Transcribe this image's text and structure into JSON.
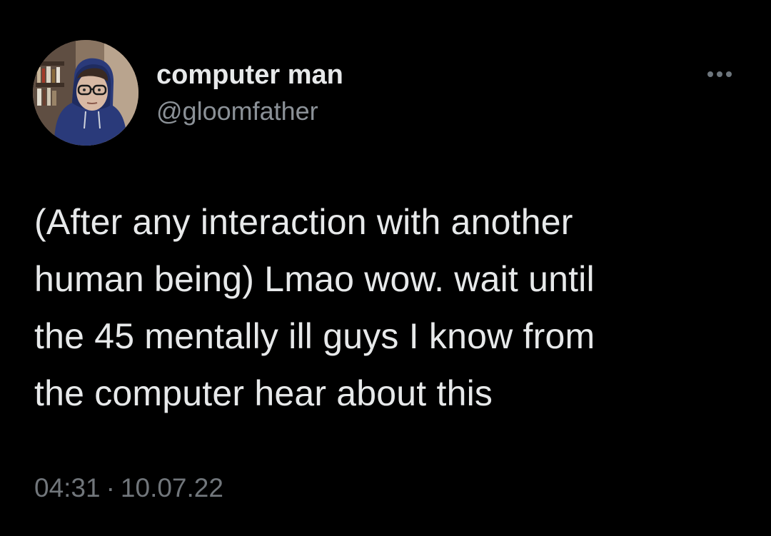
{
  "colors": {
    "background": "#000000",
    "primary_text": "#e7e9ea",
    "secondary_text": "#71767b"
  },
  "author": {
    "display_name": "computer man",
    "handle": "@gloomfather",
    "avatar_icon": "profile-photo"
  },
  "more_icon": "more-horizontal-icon",
  "tweet": {
    "lines": [
      "(After any interaction with another",
      "human being) Lmao wow. wait until",
      "the 45 mentally ill guys I know from",
      "the computer hear about this"
    ],
    "time": "04:31",
    "separator": "·",
    "date": "10.07.22"
  }
}
